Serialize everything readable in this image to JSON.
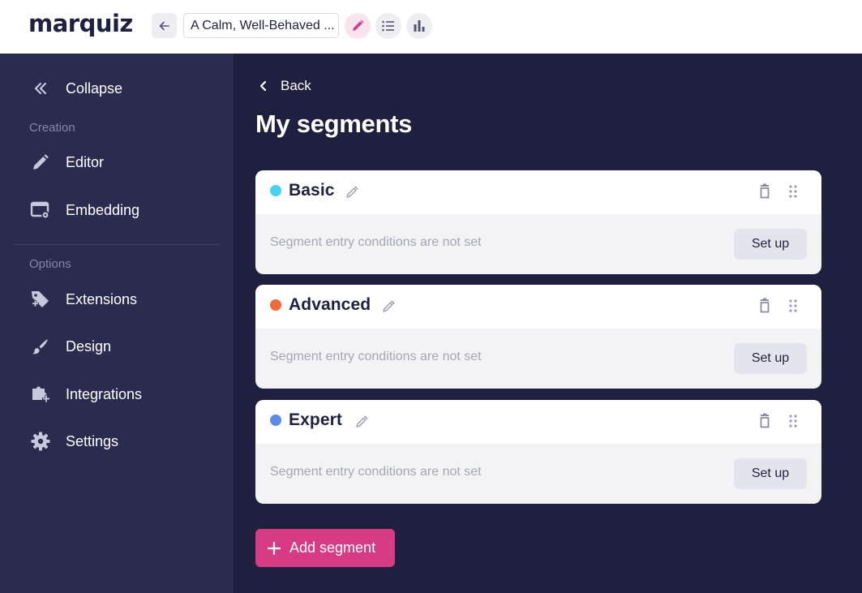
{
  "topbar": {
    "logo": "marquiz",
    "quiz_title": "A Calm, Well-Behaved ..."
  },
  "sidebar": {
    "collapse_label": "Collapse",
    "groups": {
      "creation": "Creation",
      "options": "Options"
    },
    "items": [
      {
        "label": "Editor",
        "icon": "pencil-icon"
      },
      {
        "label": "Embedding",
        "icon": "embed-settings-icon"
      },
      {
        "label": "Extensions",
        "icon": "tag-plus-icon"
      },
      {
        "label": "Design",
        "icon": "brush-icon"
      },
      {
        "label": "Integrations",
        "icon": "puzzle-plus-icon"
      },
      {
        "label": "Settings",
        "icon": "gear-icon"
      }
    ]
  },
  "main": {
    "back_label": "Back",
    "title": "My segments",
    "segments": [
      {
        "name": "Basic",
        "color": "#44d3f0",
        "condition": "Segment entry conditions are not set",
        "button": "Set up"
      },
      {
        "name": "Advanced",
        "color": "#f26a3a",
        "condition": "Segment entry conditions are not set",
        "button": "Set up"
      },
      {
        "name": "Expert",
        "color": "#5b8ae8",
        "condition": "Segment entry conditions are not set",
        "button": "Set up"
      }
    ],
    "add_label": "Add segment"
  },
  "colors": {
    "accent": "#d63b84",
    "sidebar_bg": "#2a2b4f",
    "main_bg": "#1f1f3f"
  }
}
